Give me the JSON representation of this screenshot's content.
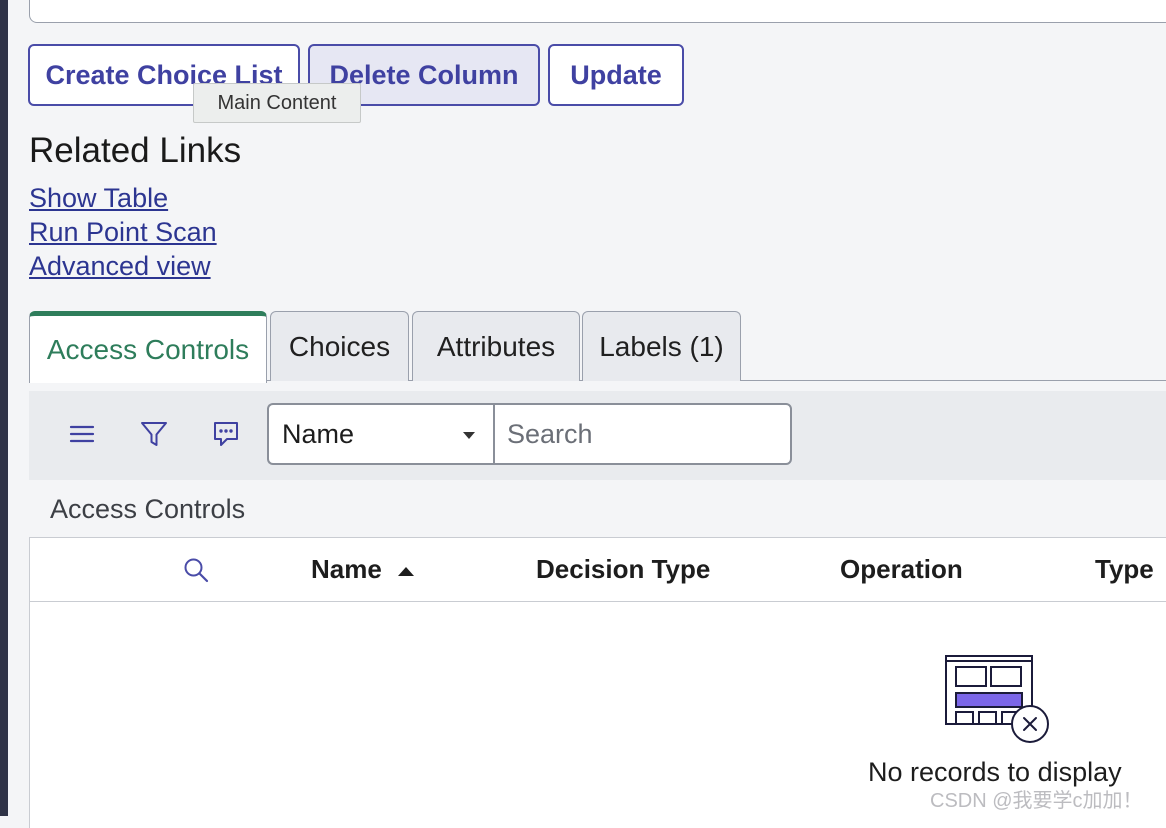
{
  "buttons": {
    "create_choice_list": "Create Choice List",
    "delete_column": "Delete Column",
    "update": "Update"
  },
  "tooltip": "Main Content",
  "related_links": {
    "title": "Related Links",
    "items": [
      "Show Table",
      "Run Point Scan",
      "Advanced view"
    ]
  },
  "tabs": [
    {
      "label": "Access Controls",
      "active": true
    },
    {
      "label": "Choices",
      "active": false
    },
    {
      "label": "Attributes",
      "active": false
    },
    {
      "label": "Labels (1)",
      "active": false
    }
  ],
  "toolbar": {
    "icons": [
      "menu-icon",
      "filter-icon",
      "comment-icon"
    ],
    "field_select": "Name",
    "search_placeholder": "Search"
  },
  "list": {
    "title": "Access Controls",
    "columns": [
      "Name",
      "Decision Type",
      "Operation",
      "Type"
    ],
    "sort_column": "Name",
    "sort_direction": "ascending",
    "empty_message": "No records to display"
  },
  "watermark": "CSDN @我要学c加加！",
  "colors": {
    "primary": "#3f41a1",
    "active_tab": "#2e7d5b",
    "link": "#2c3591",
    "illustration_accent": "#7b66e8"
  }
}
